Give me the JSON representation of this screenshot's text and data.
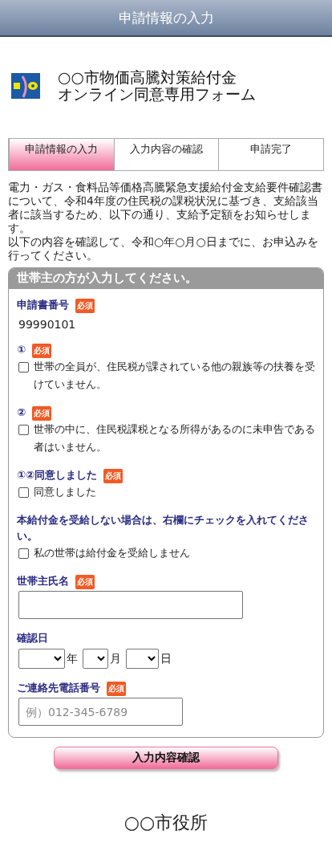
{
  "header": {
    "title": "申請情報の入力"
  },
  "brand": {
    "title_lines": [
      "○○市物価高騰対策給付金",
      "オンライン同意専用フォーム"
    ]
  },
  "steps": [
    {
      "label": "申請情報の入力",
      "selected": true
    },
    {
      "label": "入力内容の確認",
      "selected": false
    },
    {
      "label": "申請完了",
      "selected": false
    }
  ],
  "intro": [
    "電力・ガス・食料品等価格高騰緊急支援給付金支給要件確認書について、令和4年度の住民税の課税状況に基づき、支給該当者に該当するため、以下の通り、支給予定額をお知らせします。",
    "以下の内容を確認して、令和○年○月○日までに、お申込みを行ってください。"
  ],
  "form": {
    "heading": "世帯主の方が入力してください。",
    "fields": [
      {
        "kind": "static",
        "label": "申請書番号",
        "badge": "必須",
        "value": "99990101"
      },
      {
        "kind": "checkbox",
        "label": "①",
        "badge": "必須",
        "option": "世帯の全員が、住民税が課されている他の親族等の扶養を受けていません。",
        "checked": false
      },
      {
        "kind": "checkbox",
        "label": "②",
        "badge": "必須",
        "option": "世帯の中に、住民税課税となる所得があるのに未申告である者はいません。",
        "checked": false
      },
      {
        "kind": "checkbox",
        "label": "①②同意しました",
        "badge": "必須",
        "option": "同意しました",
        "checked": false
      },
      {
        "kind": "checkbox",
        "label": "本給付金を受給しない場合は、右欄にチェックを入れてください。",
        "option": "私の世帯は給付金を受給しません",
        "checked": false
      },
      {
        "kind": "text",
        "label": "世帯主氏名",
        "badge": "必須"
      },
      {
        "kind": "date",
        "label": "確認日",
        "units": [
          "年",
          "月",
          "日"
        ]
      },
      {
        "kind": "tel",
        "label": "ご連絡先電話番号",
        "badge": "必須",
        "placeholder": "例）012-345-6789"
      }
    ]
  },
  "submit": {
    "label": "入力内容確認"
  },
  "footer": {
    "text": "○○市役所"
  }
}
